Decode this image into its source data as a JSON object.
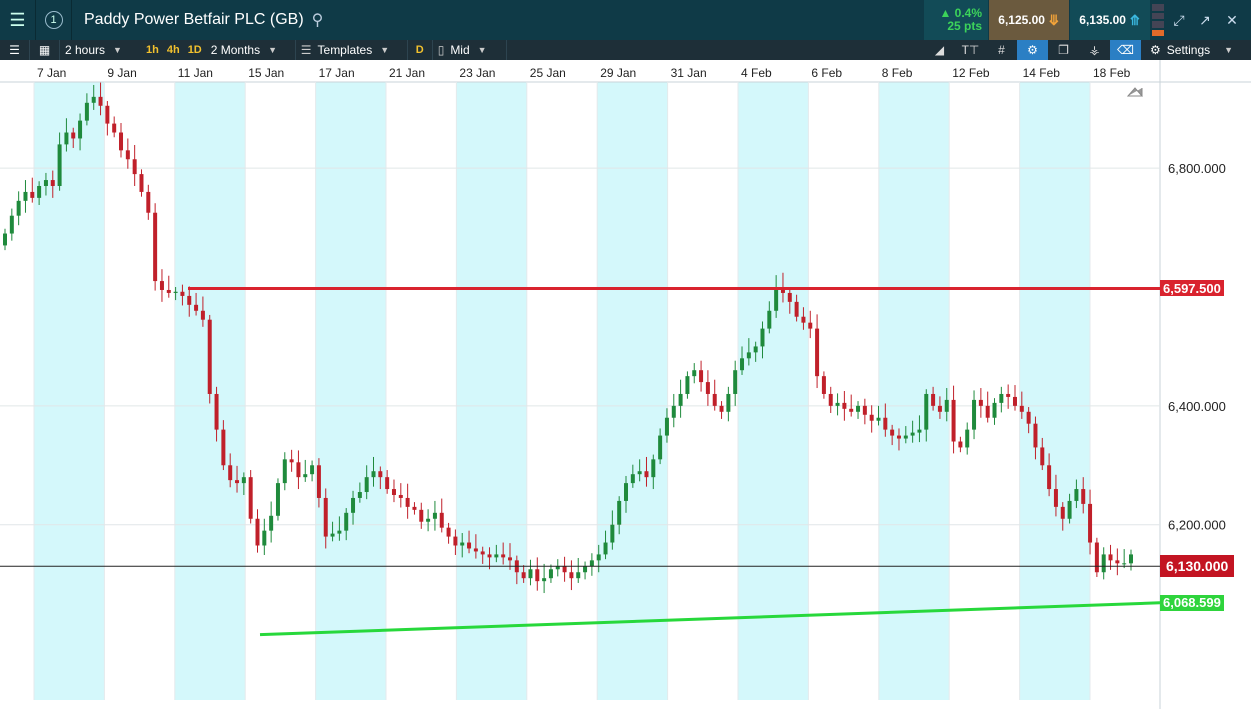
{
  "header": {
    "menu_icon": "hamburger-icon",
    "window_number": "1",
    "title": "Paddy Power Betfair PLC (GB)",
    "change_pct": "▲ 0.4%",
    "change_pts": "25 pts",
    "sell_price": "6,125.00",
    "buy_price": "6,135.00"
  },
  "toolbar": {
    "interval": "2 hours",
    "quick_intervals": [
      "1h",
      "4h",
      "1D"
    ],
    "range": "2 Months",
    "templates": "Templates",
    "d_badge": "D",
    "price_type": "Mid",
    "settings": "Settings"
  },
  "colors": {
    "band": "#d4f8fb",
    "up": "#1f8a3c",
    "down": "#c0202a",
    "resistance": "#d9232e",
    "support": "#27d83b",
    "title_bg": "#0f3a47"
  },
  "chart_data": {
    "type": "candlestick",
    "x_ticks": [
      "7 Jan",
      "9 Jan",
      "11 Jan",
      "15 Jan",
      "17 Jan",
      "21 Jan",
      "23 Jan",
      "25 Jan",
      "29 Jan",
      "31 Jan",
      "4 Feb",
      "6 Feb",
      "8 Feb",
      "12 Feb",
      "14 Feb",
      "18 Feb"
    ],
    "y_ticks": [
      "6,800.000",
      "6,400.000",
      "6,200.000"
    ],
    "y_tick_values": [
      6800,
      6400,
      6200
    ],
    "ylim": [
      5905,
      6945
    ],
    "current_price": "6,130.000",
    "current_value": 6130,
    "resistance": {
      "label": "6,597.500",
      "value": 6597.5
    },
    "support": {
      "label": "6,068.599",
      "start": 6015,
      "end": 6068.599
    },
    "grid": true,
    "bar_interval": "2 hours",
    "series_closes": [
      6690,
      6720,
      6745,
      6760,
      6750,
      6770,
      6780,
      6770,
      6840,
      6860,
      6850,
      6880,
      6910,
      6920,
      6905,
      6875,
      6860,
      6830,
      6815,
      6790,
      6760,
      6725,
      6610,
      6595,
      6590,
      6592,
      6585,
      6570,
      6560,
      6545,
      6420,
      6360,
      6300,
      6275,
      6270,
      6280,
      6210,
      6165,
      6190,
      6215,
      6270,
      6310,
      6305,
      6280,
      6285,
      6300,
      6245,
      6180,
      6185,
      6190,
      6220,
      6245,
      6255,
      6280,
      6290,
      6280,
      6260,
      6250,
      6245,
      6230,
      6225,
      6205,
      6210,
      6220,
      6195,
      6180,
      6165,
      6170,
      6160,
      6155,
      6150,
      6145,
      6150,
      6145,
      6140,
      6120,
      6110,
      6125,
      6105,
      6110,
      6125,
      6130,
      6120,
      6110,
      6120,
      6130,
      6140,
      6150,
      6170,
      6200,
      6240,
      6270,
      6285,
      6290,
      6280,
      6310,
      6350,
      6380,
      6400,
      6420,
      6450,
      6460,
      6440,
      6420,
      6400,
      6390,
      6420,
      6460,
      6480,
      6490,
      6500,
      6530,
      6560,
      6600,
      6590,
      6575,
      6550,
      6540,
      6530,
      6450,
      6420,
      6400,
      6405,
      6395,
      6390,
      6400,
      6385,
      6375,
      6380,
      6360,
      6350,
      6345,
      6350,
      6355,
      6360,
      6420,
      6400,
      6390,
      6410,
      6340,
      6330,
      6360,
      6410,
      6400,
      6380,
      6405,
      6420,
      6415,
      6400,
      6390,
      6370,
      6330,
      6300,
      6260,
      6230,
      6210,
      6240,
      6260,
      6235,
      6170,
      6120,
      6150,
      6140,
      6135,
      6135,
      6150
    ]
  }
}
